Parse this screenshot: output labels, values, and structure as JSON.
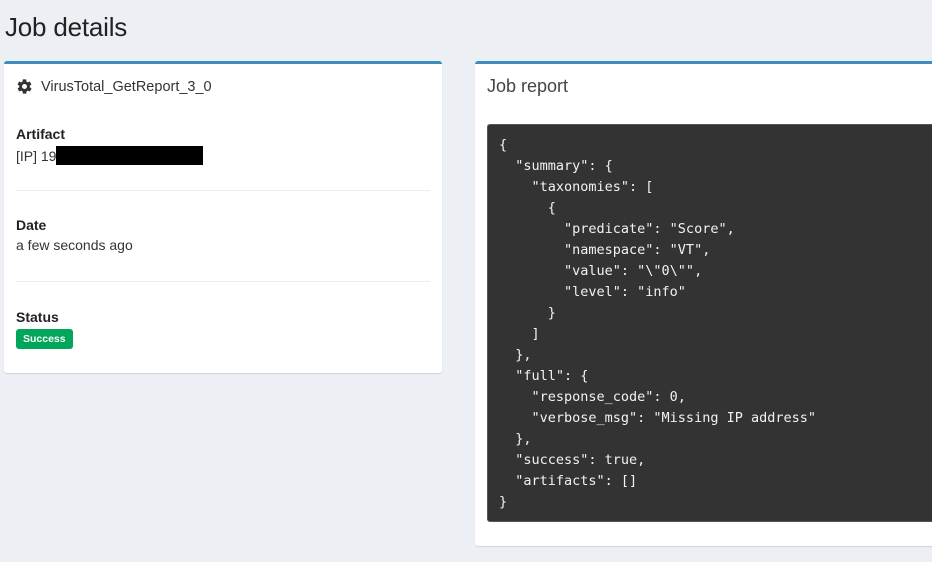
{
  "page": {
    "title": "Job details"
  },
  "job": {
    "analyzer_icon": "gear-icon",
    "analyzer_name": "VirusTotal_GetReport_3_0",
    "artifact_label": "Artifact",
    "artifact_value": "[IP] 19",
    "date_label": "Date",
    "date_value": "a few seconds ago",
    "status_label": "Status",
    "status_value": "Success",
    "status_color": "#00a65a"
  },
  "report": {
    "title": "Job report",
    "json_text": "{\n  \"summary\": {\n    \"taxonomies\": [\n      {\n        \"predicate\": \"Score\",\n        \"namespace\": \"VT\",\n        \"value\": \"\\\"0\\\"\",\n        \"level\": \"info\"\n      }\n    ]\n  },\n  \"full\": {\n    \"response_code\": 0,\n    \"verbose_msg\": \"Missing IP address\"\n  },\n  \"success\": true,\n  \"artifacts\": []\n}"
  },
  "colors": {
    "background": "#ecf0f5",
    "box_border": "#3c8dbc",
    "code_background": "#333333"
  }
}
